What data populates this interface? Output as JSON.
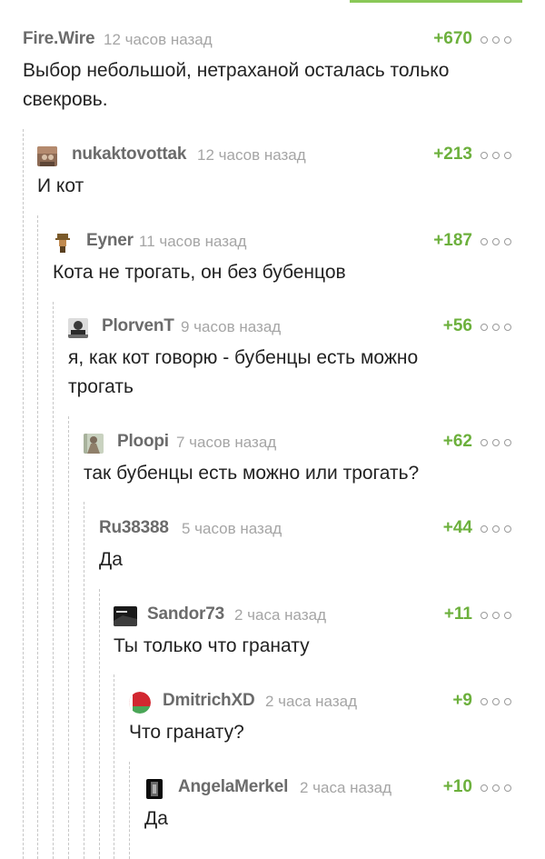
{
  "comments": [
    {
      "author": "Fire.Wire",
      "time": "12 часов назад",
      "rating": "+670",
      "text": "Выбор небольшой, нетраханой осталась только свекровь.",
      "avatar": "none"
    },
    {
      "author": "nukaktovottak",
      "time": "12 часов назад",
      "rating": "+213",
      "text": "И кот",
      "avatar": "image"
    },
    {
      "author": "Eyner",
      "time": "11 часов назад",
      "rating": "+187",
      "text": "Кота не трогать, он без бубенцов",
      "avatar": "image"
    },
    {
      "author": "PlorvenT",
      "time": "9 часов назад",
      "rating": "+56",
      "text": "я, как кот говорю - бубенцы есть можно трогать",
      "avatar": "image"
    },
    {
      "author": "Ploopi",
      "time": "7 часов назад",
      "rating": "+62",
      "text": "так бубенцы есть можно или трогать?",
      "avatar": "image"
    },
    {
      "author": "Ru38388",
      "time": "5 часов назад",
      "rating": "+44",
      "text": "Да",
      "avatar": "none"
    },
    {
      "author": "Sandor73",
      "time": "2 часа назад",
      "rating": "+11",
      "text": "Ты только что гранату",
      "avatar": "image"
    },
    {
      "author": "DmitrichXD",
      "time": "2 часа назад",
      "rating": "+9",
      "text": "Что гранату?",
      "avatar": "belarus-flag-icon"
    },
    {
      "author": "AngelaMerkel",
      "time": "2 часа назад",
      "rating": "+10",
      "text": "Да",
      "avatar": "image"
    }
  ],
  "colors": {
    "accent": "#8ac858",
    "rating": "#6cb03c",
    "author": "#6b6b6b",
    "time": "#a5a5a5"
  }
}
